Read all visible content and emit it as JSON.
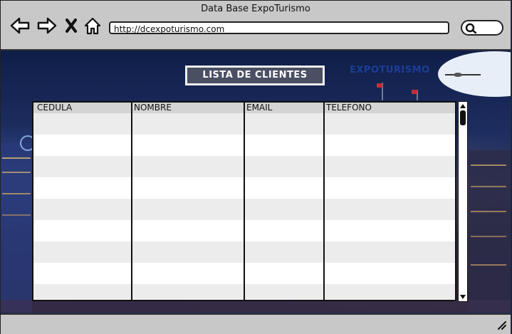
{
  "window": {
    "title": "Data Base ExpoTurismo"
  },
  "nav": {
    "back_icon": "arrow-left-icon",
    "forward_icon": "arrow-right-icon",
    "stop_icon": "x-icon",
    "home_icon": "home-icon"
  },
  "address_bar": {
    "url": "http://dcexpoturismo.com"
  },
  "search": {
    "icon": "search-icon"
  },
  "background": {
    "brand": "EXPOTURISMO"
  },
  "page": {
    "heading": "LISTA DE CLIENTES"
  },
  "table": {
    "columns": [
      "CEDULA",
      "NOMBRE",
      "EMAIL",
      "TELEFONO"
    ],
    "rows": []
  },
  "colors": {
    "chrome": "#c8c8c8",
    "heading_bg": "#4a4f63",
    "row_stripe": "#ececec",
    "header_bg": "#d4d4d4"
  }
}
